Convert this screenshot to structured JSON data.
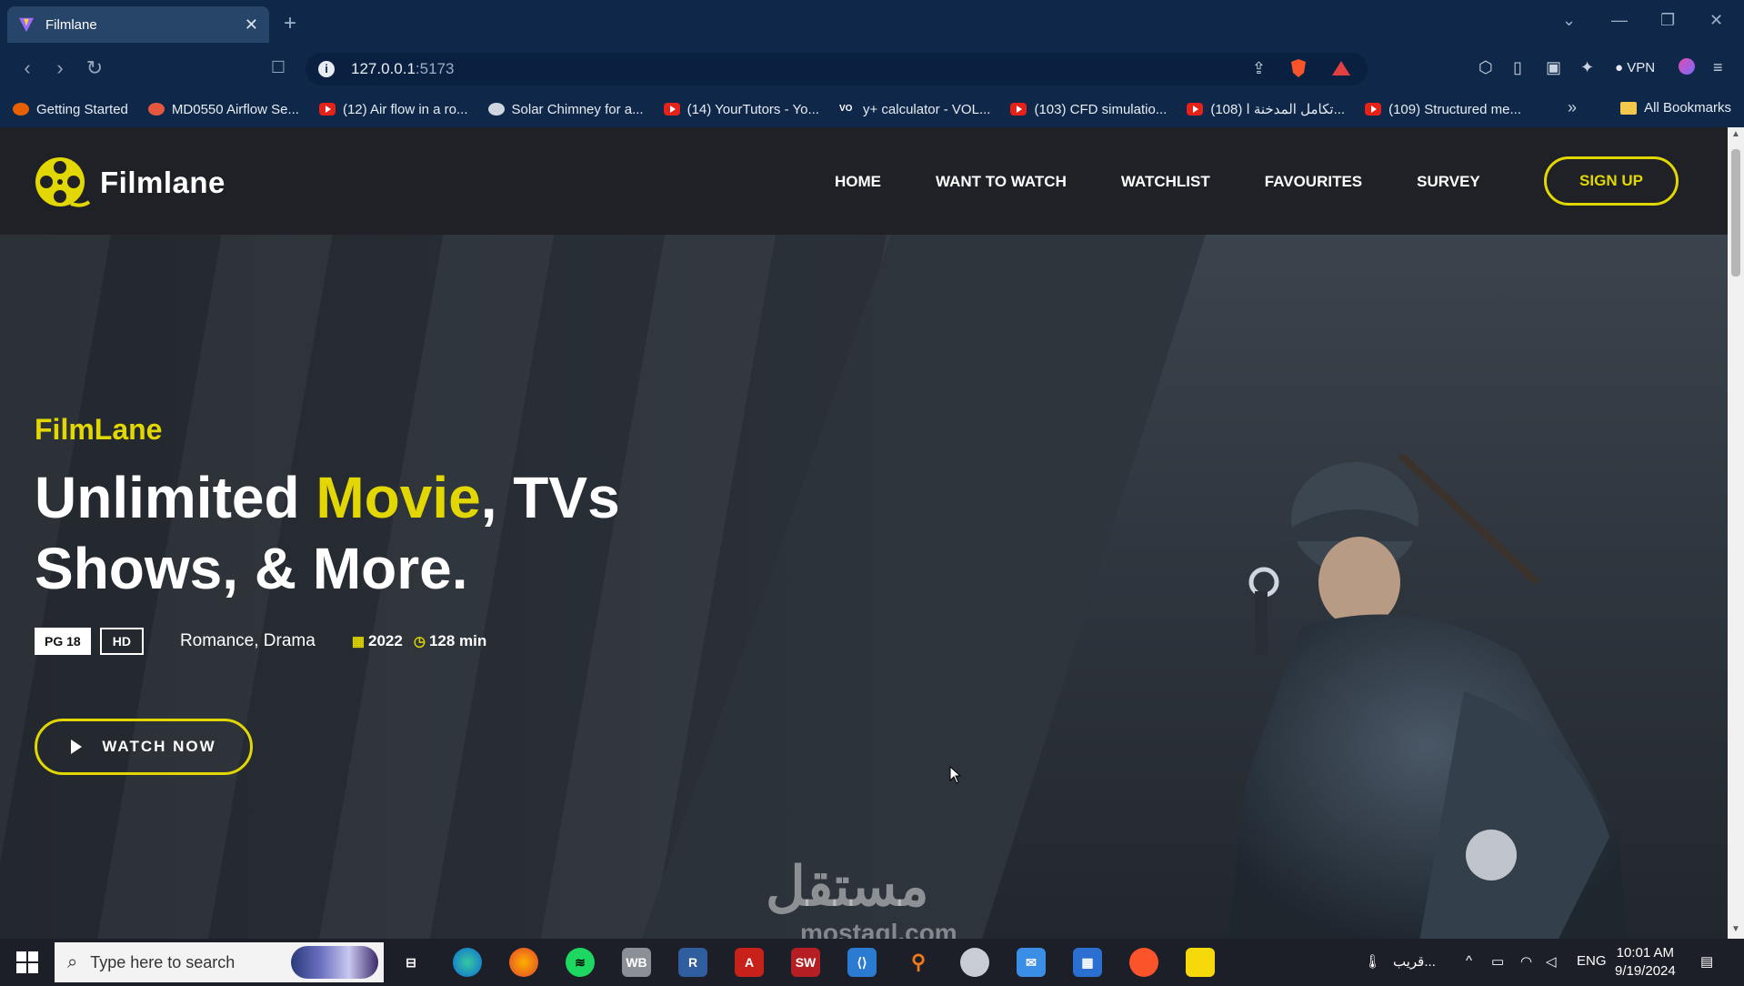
{
  "browser": {
    "tab_title": "Filmlane",
    "url_host": "127.0.0.1",
    "url_port": ":5173",
    "vpn_label": "VPN",
    "bookmarks": [
      "Getting Started",
      "MD0550 Airflow Se...",
      "(12) Air flow in a ro...",
      "Solar Chimney for a...",
      "(14) YourTutors - Yo...",
      "y+ calculator - VOL...",
      "(103) CFD simulatio...",
      "(108) تكامل المدخنة ا...",
      "(109) Structured me..."
    ],
    "all_bookmarks": "All Bookmarks"
  },
  "site": {
    "logo_text": "Filmlane",
    "nav": [
      "HOME",
      "WANT TO WATCH",
      "WATCHLIST",
      "FAVOURITES",
      "SURVEY"
    ],
    "signup": "SIGN UP"
  },
  "hero": {
    "subtitle": "FilmLane",
    "title_part1": "Unlimited ",
    "title_highlight": "Movie",
    "title_part2": ", TVs Shows, & More.",
    "badge_rating": "PG 18",
    "badge_quality": "HD",
    "genre": "Romance, Drama",
    "year": "2022",
    "duration": "128 min",
    "watch_button": "WATCH NOW"
  },
  "watermark": {
    "arabic": "مستقل",
    "latin": "mostaql.com"
  },
  "taskbar": {
    "search_placeholder": "Type here to search",
    "weather_text": "قريب...",
    "language": "ENG",
    "time": "10:01 AM",
    "date": "9/19/2024"
  },
  "colors": {
    "accent": "#e2d703",
    "header_bg": "#1f2126",
    "browser_bg": "#0f2749"
  }
}
